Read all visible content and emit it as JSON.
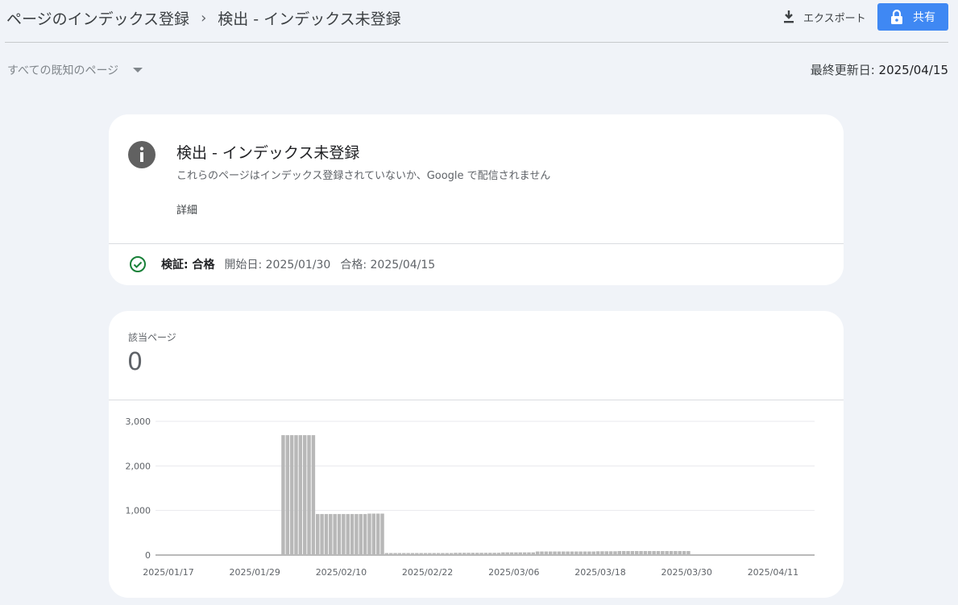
{
  "header": {
    "breadcrumb_parent": "ページのインデックス登録",
    "breadcrumb_separator": "›",
    "breadcrumb_current": "検出 - インデックス未登録",
    "export_label": "エクスポート",
    "share_label": "共有"
  },
  "filter": {
    "selected": "すべての既知のページ",
    "updated_label": "最終更新日:",
    "updated_value": "2025/04/15"
  },
  "issue": {
    "title": "検出 - インデックス未登録",
    "description": "これらのページはインデックス登録されていないか、Google で配信されません",
    "details_label": "詳細",
    "validation_label": "検証: 合格",
    "validation_start": "開始日: 2025/01/30",
    "validation_passed": "合格: 2025/04/15"
  },
  "affected": {
    "label": "該当ページ",
    "value": "0"
  },
  "colors": {
    "accent": "#3f88f3",
    "bar": "#b8b8b8",
    "check": "#188038",
    "info_icon": "#616161"
  },
  "chart_data": {
    "type": "bar",
    "x_tick_labels": [
      "2025/01/17",
      "2025/01/29",
      "2025/02/10",
      "2025/02/22",
      "2025/03/06",
      "2025/03/18",
      "2025/03/30",
      "2025/04/11"
    ],
    "y_tick_labels": [
      "0",
      "1,000",
      "2,000",
      "3,000"
    ],
    "ylim": [
      0,
      3000
    ],
    "grid": true,
    "start_date": "2025/01/17",
    "values": [
      0,
      0,
      0,
      0,
      0,
      0,
      0,
      0,
      0,
      0,
      0,
      0,
      2690,
      2690,
      2690,
      2690,
      2690,
      2690,
      2690,
      2690,
      920,
      920,
      920,
      920,
      920,
      920,
      920,
      920,
      920,
      920,
      920,
      920,
      930,
      930,
      930,
      930,
      45,
      45,
      45,
      45,
      45,
      45,
      45,
      45,
      45,
      45,
      45,
      45,
      45,
      45,
      45,
      45,
      50,
      50,
      50,
      50,
      50,
      50,
      50,
      50,
      50,
      50,
      50,
      60,
      60,
      60,
      60,
      60,
      60,
      60,
      60,
      80,
      80,
      80,
      80,
      80,
      80,
      80,
      80,
      80,
      80,
      80,
      80,
      80,
      80,
      85,
      85,
      85,
      85,
      85,
      90,
      90,
      90,
      90,
      90,
      90,
      90,
      90,
      90,
      90,
      90,
      90,
      90,
      90,
      90,
      90,
      90
    ]
  }
}
